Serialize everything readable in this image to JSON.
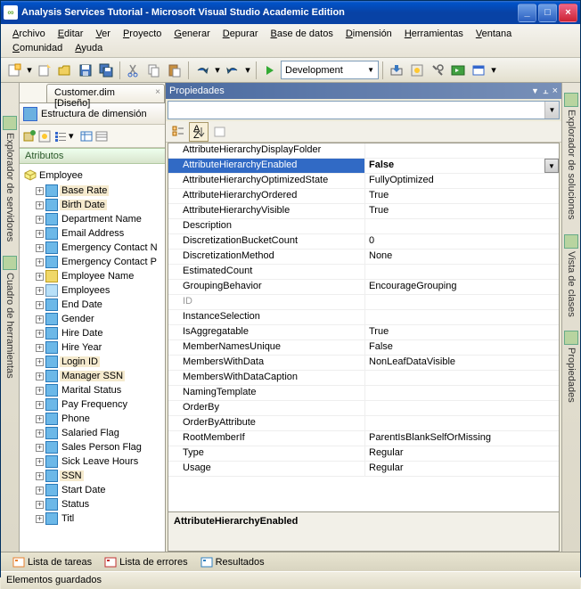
{
  "window": {
    "title": "Analysis Services Tutorial - Microsoft Visual Studio Academic Edition"
  },
  "menus": [
    "Archivo",
    "Editar",
    "Ver",
    "Proyecto",
    "Generar",
    "Depurar",
    "Base de datos",
    "Dimensión",
    "Herramientas",
    "Ventana",
    "Comunidad",
    "Ayuda"
  ],
  "config": {
    "label": "Development"
  },
  "doc_tab": {
    "label": "Customer.dim [Diseño]"
  },
  "struct": {
    "label": "Estructura de dimensión"
  },
  "attr_header": "Atributos",
  "tree_root": "Employee",
  "tree_items": [
    {
      "label": "Base Rate",
      "hl": true,
      "icon": "attr"
    },
    {
      "label": "Birth Date",
      "hl": true,
      "icon": "attr"
    },
    {
      "label": "Department Name",
      "hl": false,
      "icon": "attr"
    },
    {
      "label": "Email Address",
      "hl": false,
      "icon": "attr"
    },
    {
      "label": "Emergency Contact N",
      "hl": false,
      "icon": "attr"
    },
    {
      "label": "Emergency Contact P",
      "hl": false,
      "icon": "attr"
    },
    {
      "label": "Employee Name",
      "hl": false,
      "icon": "key"
    },
    {
      "label": "Employees",
      "hl": false,
      "icon": "group"
    },
    {
      "label": "End Date",
      "hl": false,
      "icon": "attr"
    },
    {
      "label": "Gender",
      "hl": false,
      "icon": "attr"
    },
    {
      "label": "Hire Date",
      "hl": false,
      "icon": "attr"
    },
    {
      "label": "Hire Year",
      "hl": false,
      "icon": "attr"
    },
    {
      "label": "Login ID",
      "hl": true,
      "icon": "attr"
    },
    {
      "label": "Manager SSN",
      "hl": true,
      "icon": "attr"
    },
    {
      "label": "Marital Status",
      "hl": false,
      "icon": "attr"
    },
    {
      "label": "Pay Frequency",
      "hl": false,
      "icon": "attr"
    },
    {
      "label": "Phone",
      "hl": false,
      "icon": "attr"
    },
    {
      "label": "Salaried Flag",
      "hl": false,
      "icon": "attr"
    },
    {
      "label": "Sales Person Flag",
      "hl": false,
      "icon": "attr"
    },
    {
      "label": "Sick Leave Hours",
      "hl": false,
      "icon": "attr"
    },
    {
      "label": "SSN",
      "hl": true,
      "icon": "attr"
    },
    {
      "label": "Start Date",
      "hl": false,
      "icon": "attr"
    },
    {
      "label": "Status",
      "hl": false,
      "icon": "attr"
    },
    {
      "label": "Titl",
      "hl": false,
      "icon": "attr"
    }
  ],
  "props_title": "Propiedades",
  "props": [
    {
      "name": "AttributeHierarchyDisplayFolder",
      "val": "",
      "sel": false
    },
    {
      "name": "AttributeHierarchyEnabled",
      "val": "False",
      "sel": true
    },
    {
      "name": "AttributeHierarchyOptimizedState",
      "val": "FullyOptimized",
      "sel": false
    },
    {
      "name": "AttributeHierarchyOrdered",
      "val": "True",
      "sel": false
    },
    {
      "name": "AttributeHierarchyVisible",
      "val": "True",
      "sel": false
    },
    {
      "name": "Description",
      "val": "",
      "sel": false
    },
    {
      "name": "DiscretizationBucketCount",
      "val": "0",
      "sel": false
    },
    {
      "name": "DiscretizationMethod",
      "val": "None",
      "sel": false
    },
    {
      "name": "EstimatedCount",
      "val": "",
      "sel": false
    },
    {
      "name": "GroupingBehavior",
      "val": "EncourageGrouping",
      "sel": false
    },
    {
      "name": "ID",
      "val": "",
      "sel": false,
      "disabled": true
    },
    {
      "name": "InstanceSelection",
      "val": "",
      "sel": false
    },
    {
      "name": "IsAggregatable",
      "val": "True",
      "sel": false
    },
    {
      "name": "MemberNamesUnique",
      "val": "False",
      "sel": false
    },
    {
      "name": "MembersWithData",
      "val": "NonLeafDataVisible",
      "sel": false
    },
    {
      "name": "MembersWithDataCaption",
      "val": "",
      "sel": false
    },
    {
      "name": "NamingTemplate",
      "val": "",
      "sel": false
    },
    {
      "name": "OrderBy",
      "val": "",
      "sel": false
    },
    {
      "name": "OrderByAttribute",
      "val": "",
      "sel": false
    },
    {
      "name": "RootMemberIf",
      "val": "ParentIsBlankSelfOrMissing",
      "sel": false
    },
    {
      "name": "Type",
      "val": "Regular",
      "sel": false
    },
    {
      "name": "Usage",
      "val": "Regular",
      "sel": false
    }
  ],
  "props_desc": "AttributeHierarchyEnabled",
  "left_tabs": [
    "Explorador de servidores",
    "Cuadro de herramientas"
  ],
  "right_tabs": [
    "Explorador de soluciones",
    "Vista de clases",
    "Propiedades"
  ],
  "bottom_tabs": [
    "Lista de tareas",
    "Lista de errores",
    "Resultados"
  ],
  "status": "Elementos guardados"
}
